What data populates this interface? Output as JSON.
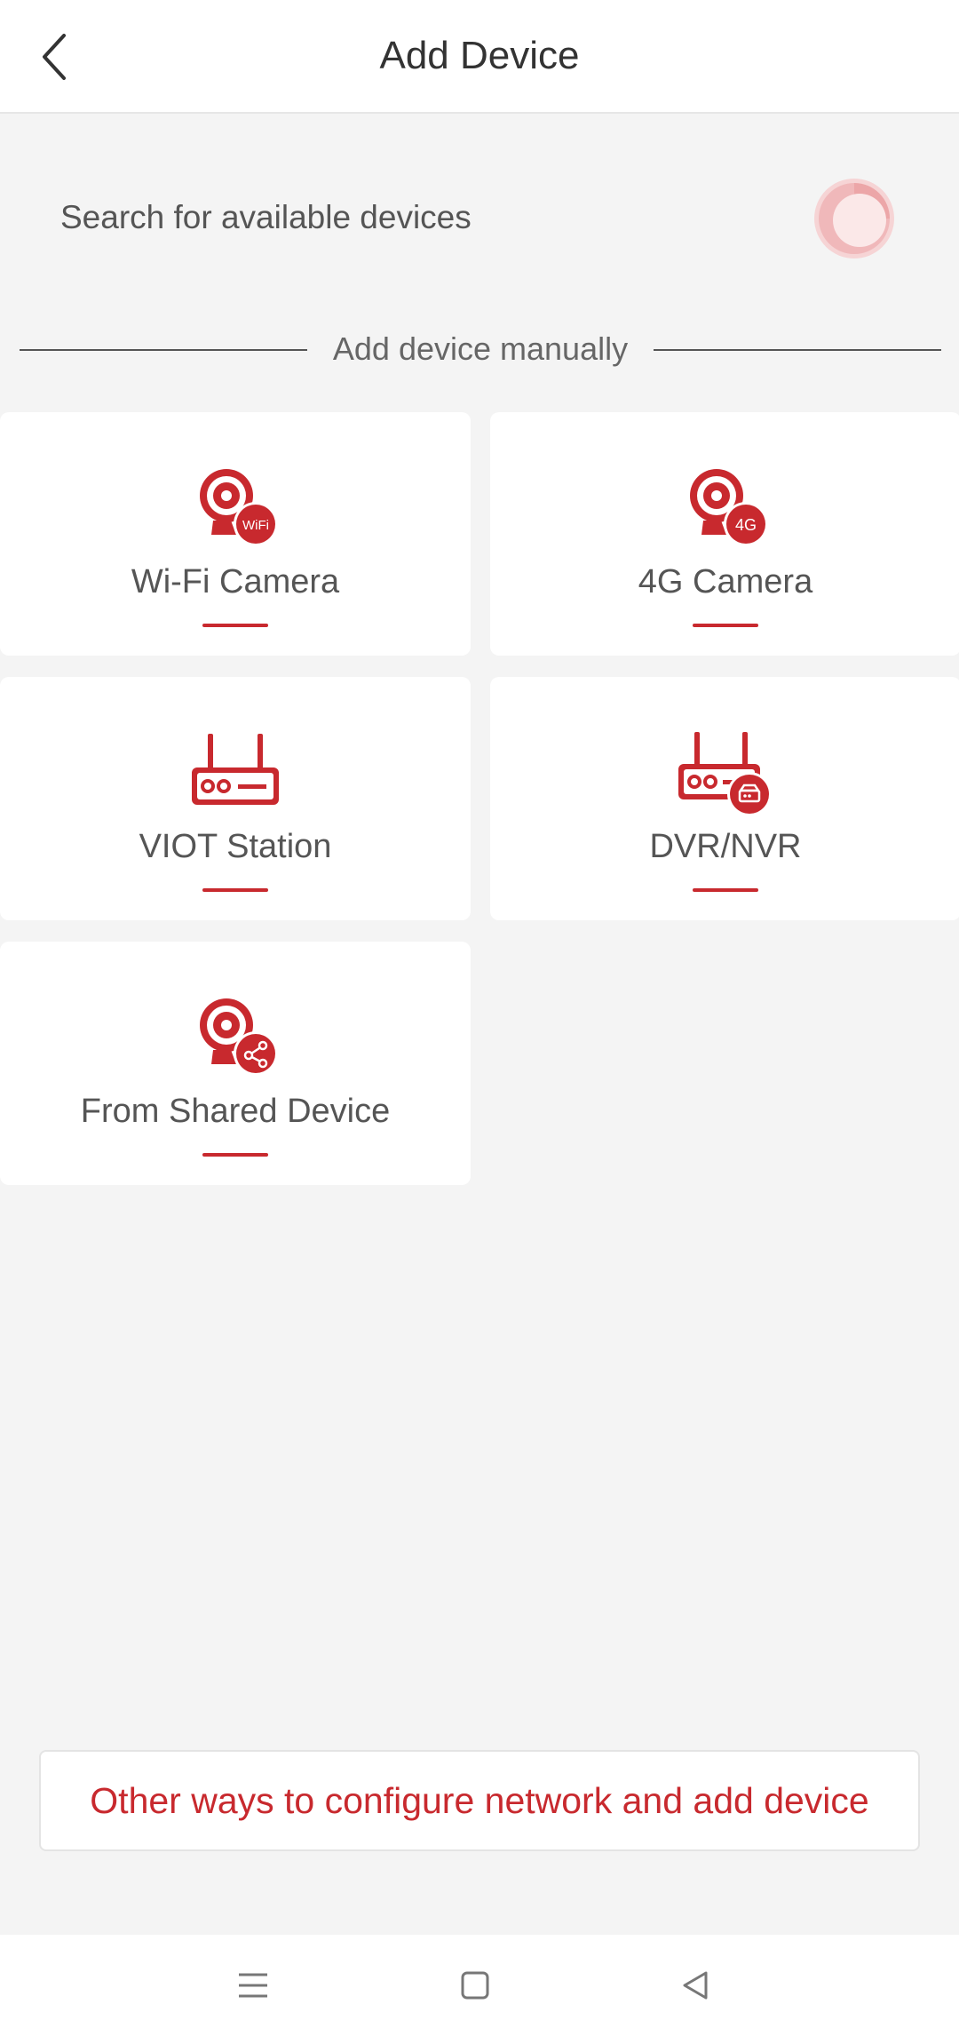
{
  "header": {
    "title": "Add Device",
    "back_icon": "chevron-left-icon"
  },
  "search": {
    "label": "Search for available devices",
    "icon": "radar-scan-icon"
  },
  "manual": {
    "label": "Add device manually"
  },
  "devices": [
    {
      "label": "Wi-Fi Camera",
      "icon": "wifi-camera-icon",
      "badge": "WiFi"
    },
    {
      "label": "4G Camera",
      "icon": "4g-camera-icon",
      "badge": "4G"
    },
    {
      "label": "VIOT Station",
      "icon": "router-station-icon"
    },
    {
      "label": "DVR/NVR",
      "icon": "dvr-nvr-icon"
    },
    {
      "label": "From Shared Device",
      "icon": "shared-camera-icon"
    }
  ],
  "footer": {
    "other_ways": "Other ways to configure network and add device"
  },
  "navbar": {
    "icons": [
      "menu-icon",
      "home-square-icon",
      "back-triangle-icon"
    ]
  },
  "colors": {
    "accent": "#c8292e",
    "background": "#f4f4f4",
    "card": "#ffffff"
  }
}
